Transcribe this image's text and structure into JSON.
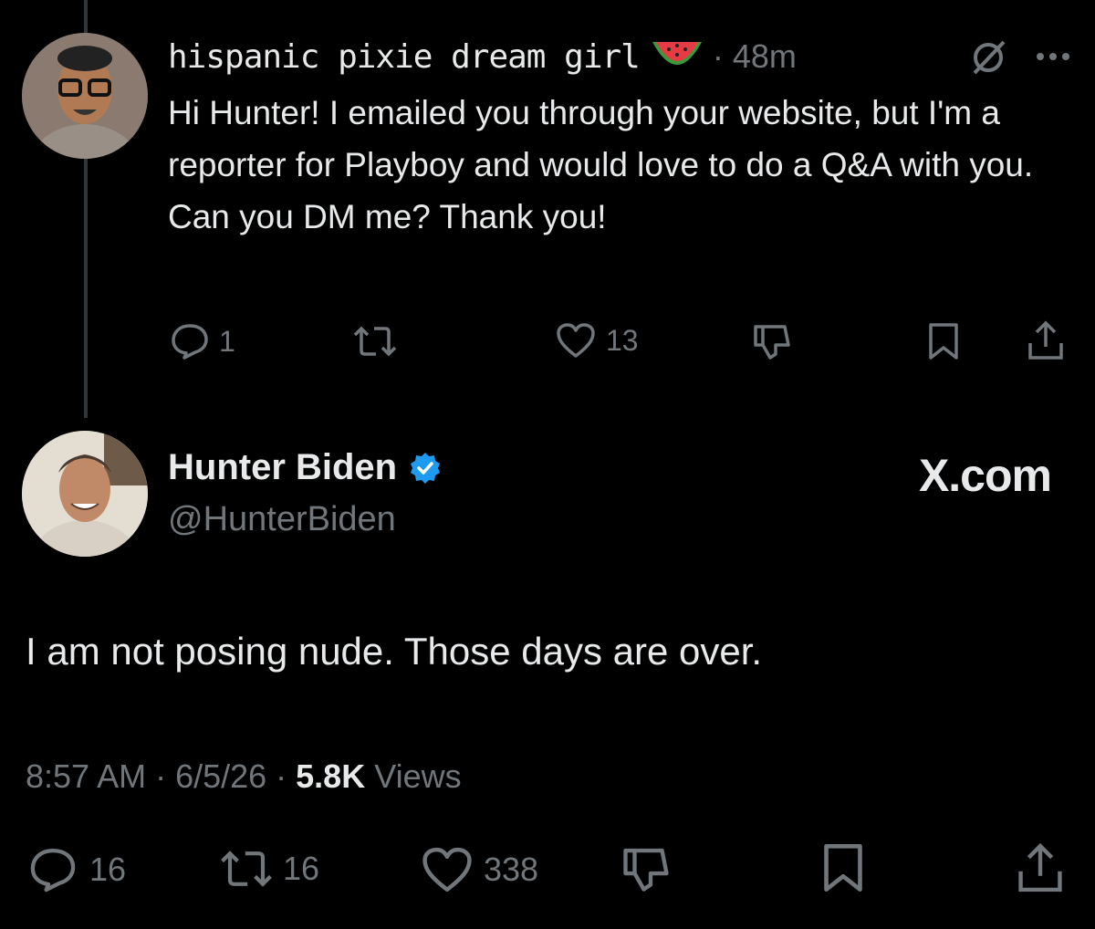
{
  "reply": {
    "display_name": "hispanic pixie dream girl",
    "emoji": "watermelon",
    "time": "· 48m",
    "text": "Hi Hunter! I emailed you through your website, but I'm a reporter for Playboy and would love to do a Q&A with you. Can you DM me? Thank you!",
    "replies": "1",
    "reposts": "",
    "likes": "13"
  },
  "post": {
    "display_name": "Hunter Biden",
    "handle": "@HunterBiden",
    "watermark": "X.com",
    "text": "I am not posing nude. Those days are over.",
    "timestamp": "8:57 AM · 6/5/26 · ",
    "views_count": "5.8K",
    "views_label": " Views",
    "replies": "16",
    "reposts": "16",
    "likes": "338"
  },
  "colors": {
    "background": "#000000",
    "text": "#e7e9ea",
    "muted": "#71767b",
    "verified": "#1d9bf0"
  }
}
